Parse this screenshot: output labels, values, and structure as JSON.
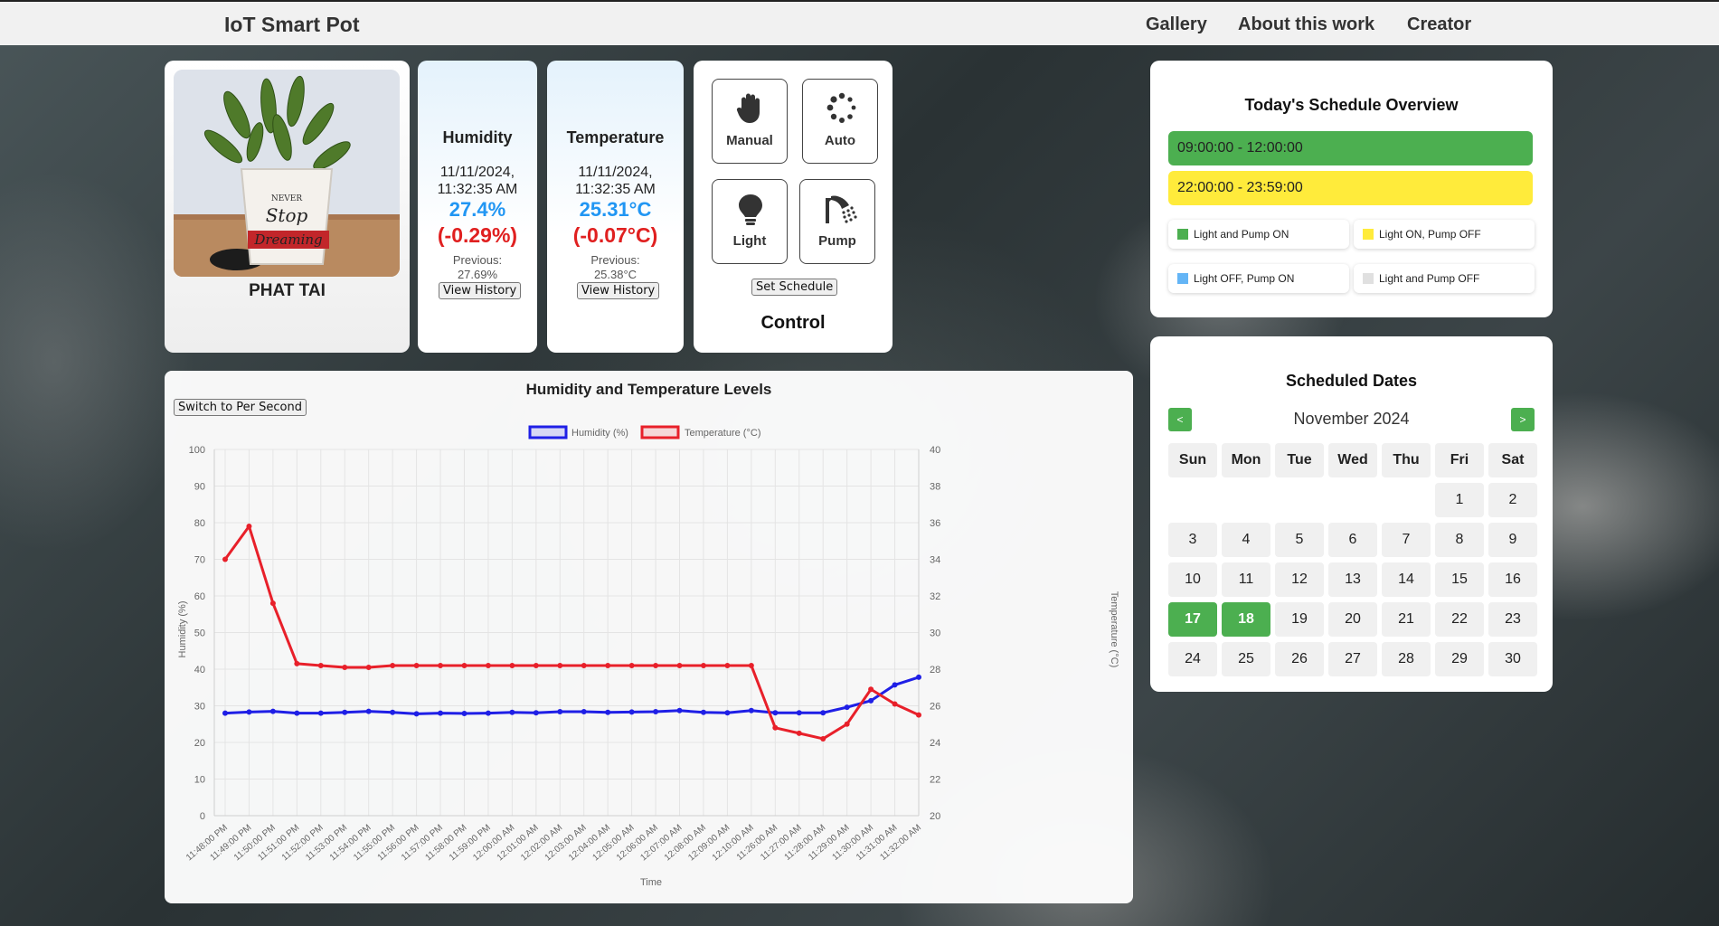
{
  "navbar": {
    "brand": "IoT Smart Pot",
    "links": [
      "Gallery",
      "About this work",
      "Creator"
    ]
  },
  "plant": {
    "name": "PHAT TAI",
    "pot_text": [
      "NEVER",
      "Stop",
      "Dreaming"
    ]
  },
  "humidity": {
    "title": "Humidity",
    "date": "11/11/2024,",
    "time": "11:32:35 AM",
    "value": "27.4%",
    "change": "(-0.29%)",
    "previous_label": "Previous:",
    "previous_value": "27.69%",
    "history_button": "View History"
  },
  "temperature": {
    "title": "Temperature",
    "date": "11/11/2024,",
    "time": "11:32:35 AM",
    "value": "25.31°C",
    "change": "(-0.07°C)",
    "previous_label": "Previous:",
    "previous_value": "25.38°C",
    "history_button": "View History"
  },
  "control": {
    "title": "Control",
    "manual": "Manual",
    "auto": "Auto",
    "light": "Light",
    "pump": "Pump",
    "set_schedule": "Set Schedule",
    "icons": [
      "hand-icon",
      "spinner-icon",
      "lightbulb-icon",
      "shower-icon"
    ]
  },
  "schedule": {
    "title": "Today's Schedule Overview",
    "slots": [
      {
        "time": "09:00:00 - 12:00:00",
        "color": "#4caf50"
      },
      {
        "time": "22:00:00 - 23:59:00",
        "color": "#ffeb3b"
      }
    ],
    "legend": [
      {
        "label": "Light and Pump ON",
        "color": "#4caf50"
      },
      {
        "label": "Light ON, Pump OFF",
        "color": "#ffeb3b"
      },
      {
        "label": "Light OFF, Pump ON",
        "color": "#64b5f6"
      },
      {
        "label": "Light and Pump OFF",
        "color": "#e0e0e0"
      }
    ]
  },
  "calendar": {
    "title": "Scheduled Dates",
    "month": "November 2024",
    "prev": "<",
    "next": ">",
    "weekdays": [
      "Sun",
      "Mon",
      "Tue",
      "Wed",
      "Thu",
      "Fri",
      "Sat"
    ],
    "first_weekday": 5,
    "days": 30,
    "selected": [
      17,
      18
    ]
  },
  "chart": {
    "toggle_button": "Switch to Per Second"
  },
  "chart_data": {
    "type": "line",
    "title": "Humidity and Temperature Levels",
    "xlabel": "Time",
    "ylabel": "Humidity (%)",
    "y2label": "Temperature (°C)",
    "ylim": [
      0,
      100
    ],
    "y2lim": [
      20,
      40
    ],
    "yticks": [
      0,
      10,
      20,
      30,
      40,
      50,
      60,
      70,
      80,
      90,
      100
    ],
    "y2ticks": [
      20,
      22,
      24,
      26,
      28,
      30,
      32,
      34,
      36,
      38,
      40
    ],
    "legend_position": "top",
    "grid": true,
    "x": [
      "11:48:00 PM",
      "11:49:00 PM",
      "11:50:00 PM",
      "11:51:00 PM",
      "11:52:00 PM",
      "11:53:00 PM",
      "11:54:00 PM",
      "11:55:00 PM",
      "11:56:00 PM",
      "11:57:00 PM",
      "11:58:00 PM",
      "11:59:00 PM",
      "12:00:00 AM",
      "12:01:00 AM",
      "12:02:00 AM",
      "12:03:00 AM",
      "12:04:00 AM",
      "12:05:00 AM",
      "12:06:00 AM",
      "12:07:00 AM",
      "12:08:00 AM",
      "12:09:00 AM",
      "12:10:00 AM",
      "11:26:00 AM",
      "11:27:00 AM",
      "11:28:00 AM",
      "11:29:00 AM",
      "11:30:00 AM",
      "11:31:00 AM",
      "11:32:00 AM"
    ],
    "series": [
      {
        "name": "Humidity (%)",
        "axis": "left",
        "color": "#1f1fe6",
        "values": [
          28,
          28.3,
          28.5,
          28,
          28,
          28.2,
          28.5,
          28.2,
          27.8,
          28,
          27.9,
          28,
          28.2,
          28.1,
          28.4,
          28.4,
          28.2,
          28.3,
          28.4,
          28.7,
          28.2,
          28.1,
          28.7,
          28.1,
          28.1,
          28.1,
          29.6,
          31.4,
          35.7,
          37.8
        ]
      },
      {
        "name": "Temperature (°C)",
        "axis": "right",
        "color": "#e8202a",
        "values": [
          34,
          35.8,
          31.6,
          28.3,
          28.2,
          28.1,
          28.1,
          28.2,
          28.2,
          28.2,
          28.2,
          28.2,
          28.2,
          28.2,
          28.2,
          28.2,
          28.2,
          28.2,
          28.2,
          28.2,
          28.2,
          28.2,
          28.2,
          24.8,
          24.5,
          24.2,
          25,
          26.9,
          26.1,
          25.5
        ]
      }
    ]
  }
}
